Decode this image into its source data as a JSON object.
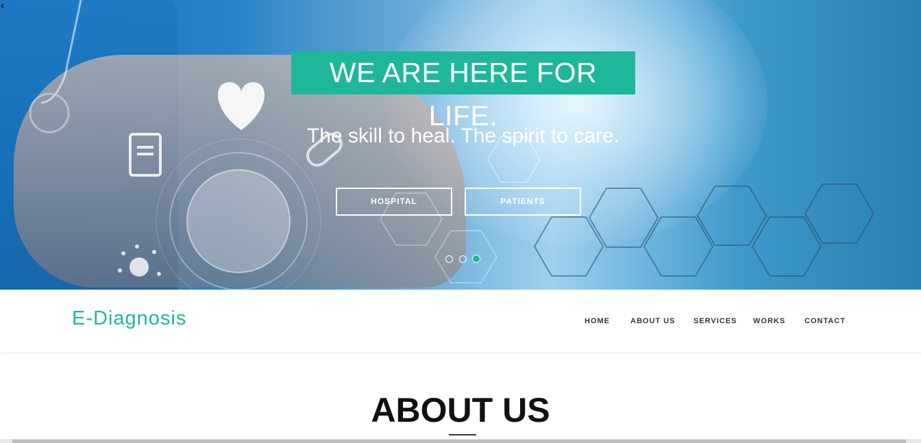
{
  "hero": {
    "back_icon": "chevron-left-icon",
    "banner": "WE ARE HERE FOR LIFE.",
    "subtitle": "The skill to heal. The spirit to care.",
    "buttons": [
      {
        "label": "HOSPITAL"
      },
      {
        "label": "PATIENTS"
      }
    ],
    "slides": {
      "count": 3,
      "active": 3
    },
    "accent_color": "#1eb79a"
  },
  "navbar": {
    "brand": "E-Diagnosis",
    "items": [
      "HOME",
      "ABOUT US",
      "SERVICES",
      "WORKS",
      "CONTACT"
    ]
  },
  "about": {
    "title": "ABOUT US"
  }
}
